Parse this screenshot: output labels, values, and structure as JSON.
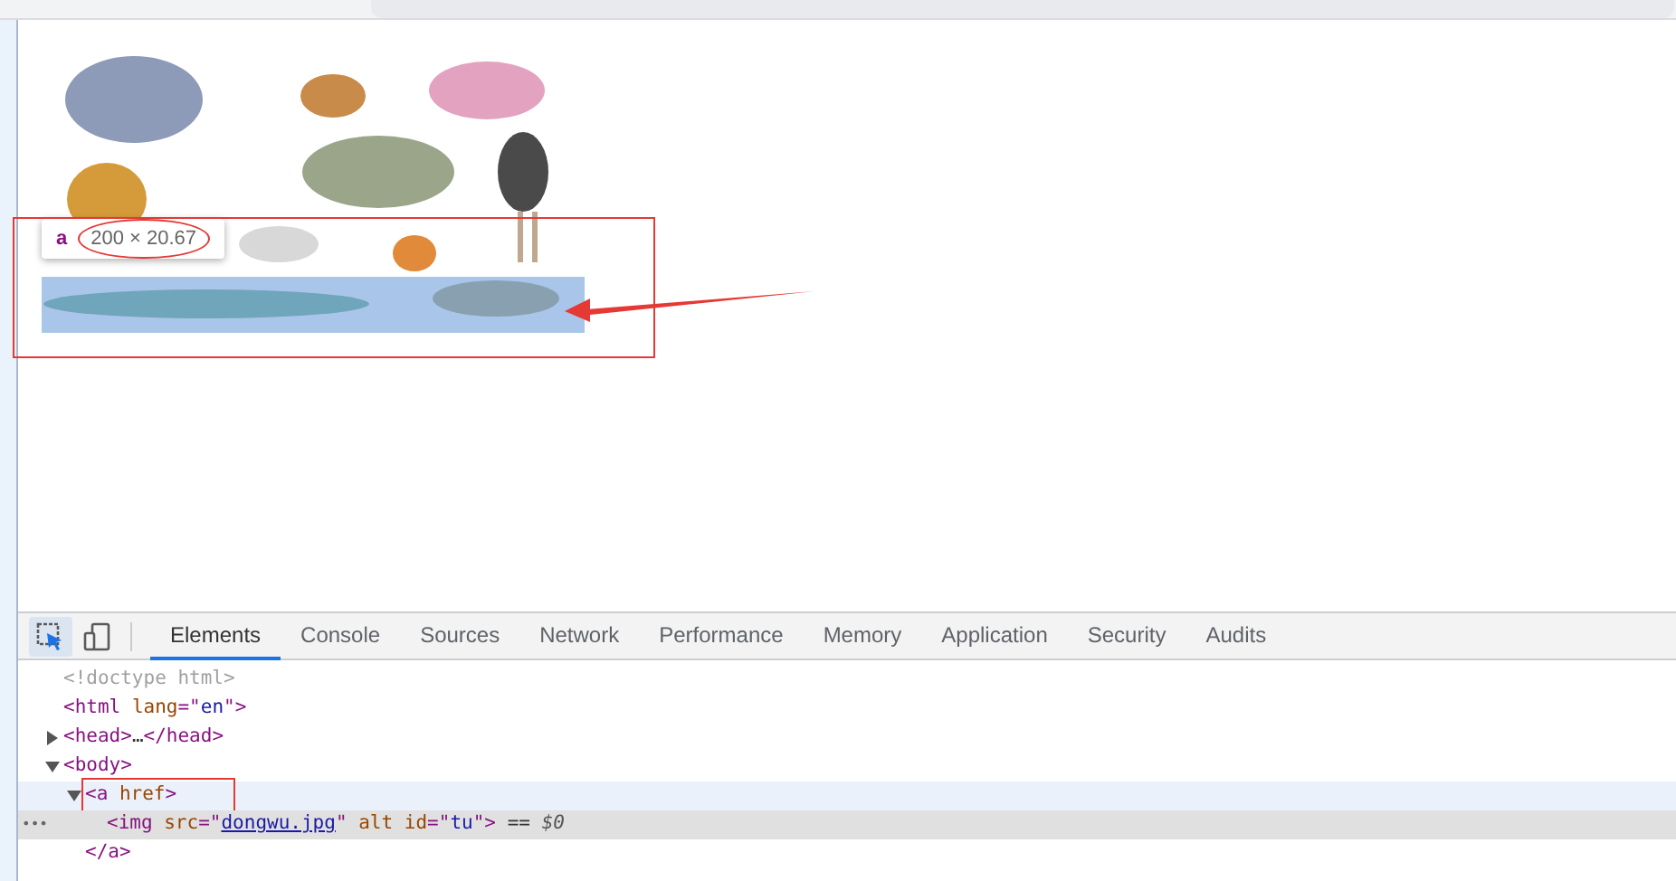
{
  "inspect_tooltip": {
    "tag": "a",
    "size": "200 × 20.67"
  },
  "devtools": {
    "tabs": [
      {
        "label": "Elements",
        "selected": true
      },
      {
        "label": "Console",
        "selected": false
      },
      {
        "label": "Sources",
        "selected": false
      },
      {
        "label": "Network",
        "selected": false
      },
      {
        "label": "Performance",
        "selected": false
      },
      {
        "label": "Memory",
        "selected": false
      },
      {
        "label": "Application",
        "selected": false
      },
      {
        "label": "Security",
        "selected": false
      },
      {
        "label": "Audits",
        "selected": false
      }
    ],
    "dom_tree": [
      {
        "selected": false,
        "hovered": false,
        "tokens": [
          {
            "kind": "doctype",
            "text": "<!doctype html>"
          }
        ]
      },
      {
        "selected": false,
        "hovered": false,
        "tokens": [
          {
            "kind": "tag",
            "text": "<html "
          },
          {
            "kind": "attr",
            "text": "lang"
          },
          {
            "kind": "tag",
            "text": "=\""
          },
          {
            "kind": "value",
            "text": "en"
          },
          {
            "kind": "tag",
            "text": "\">"
          }
        ]
      },
      {
        "selected": false,
        "hovered": false,
        "expanded": false,
        "tokens": [
          {
            "kind": "tag",
            "text": "<head>"
          },
          {
            "kind": "plain",
            "text": "…"
          },
          {
            "kind": "tag",
            "text": "</head>"
          }
        ]
      },
      {
        "selected": false,
        "hovered": false,
        "expanded": true,
        "tokens": [
          {
            "kind": "tag",
            "text": "<body>"
          }
        ],
        "children": [
          {
            "selected": false,
            "hovered": true,
            "expanded": true,
            "tokens": [
              {
                "kind": "tag",
                "text": "<a "
              },
              {
                "kind": "attr",
                "text": "href"
              },
              {
                "kind": "tag",
                "text": ">"
              }
            ],
            "close_tokens": [
              {
                "kind": "tag",
                "text": "</a>"
              }
            ],
            "children": [
              {
                "selected": true,
                "hovered": false,
                "tokens": [
                  {
                    "kind": "tag",
                    "text": "<img "
                  },
                  {
                    "kind": "attr",
                    "text": "src"
                  },
                  {
                    "kind": "tag",
                    "text": "=\""
                  },
                  {
                    "kind": "link",
                    "text": "dongwu.jpg"
                  },
                  {
                    "kind": "tag",
                    "text": "\" "
                  },
                  {
                    "kind": "attr",
                    "text": "alt id"
                  },
                  {
                    "kind": "tag",
                    "text": "=\""
                  },
                  {
                    "kind": "value",
                    "text": "tu"
                  },
                  {
                    "kind": "tag",
                    "text": "\">"
                  },
                  {
                    "kind": "plain",
                    "text": " == "
                  },
                  {
                    "kind": "var",
                    "text": "$0"
                  }
                ]
              }
            ]
          }
        ]
      }
    ],
    "selected_marker": "•••"
  }
}
